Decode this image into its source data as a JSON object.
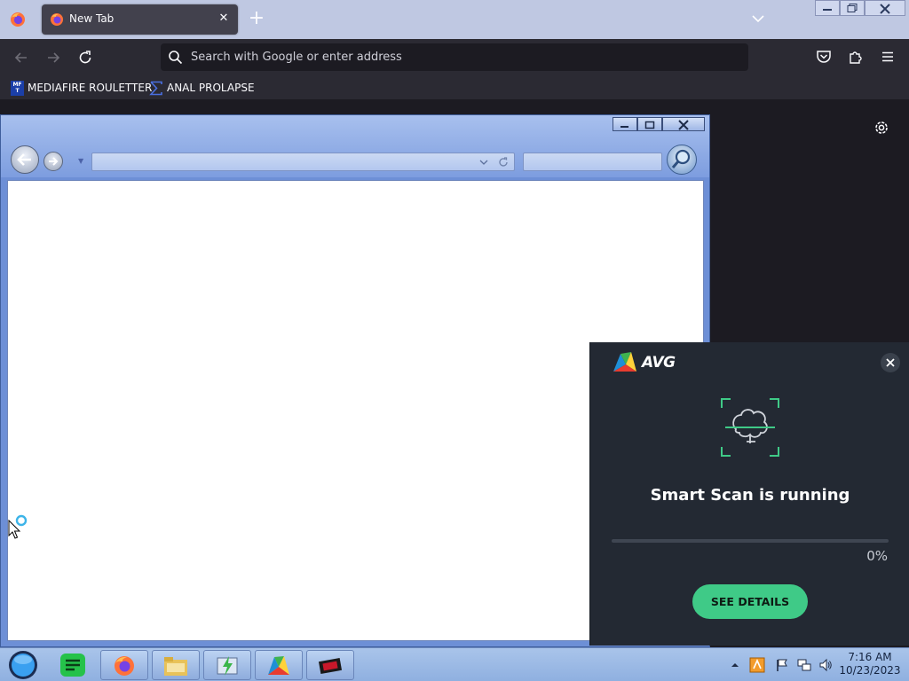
{
  "firefox": {
    "tabs": [
      {
        "title": "New Tab",
        "active": true
      }
    ],
    "url_placeholder": "Search with Google or enter address",
    "bookmarks": [
      {
        "label": "MEDIAFIRE ROULETTER",
        "icon": "mediafire-icon",
        "icon_text": "MF T"
      },
      {
        "label": "ANAL PROLAPSE",
        "icon": "sigma-icon"
      }
    ]
  },
  "avg": {
    "brand": "AVG",
    "title": "Smart Scan is running",
    "progress_percent": 0,
    "progress_text": "0%",
    "button_label": "SEE DETAILS",
    "accent_color": "#3fca87"
  },
  "taskbar": {
    "apps": [
      "firefox",
      "file-explorer",
      "avg-update",
      "avg-antivirus",
      "media-app"
    ],
    "clock_time": "7:16 AM",
    "clock_date": "10/23/2023"
  }
}
